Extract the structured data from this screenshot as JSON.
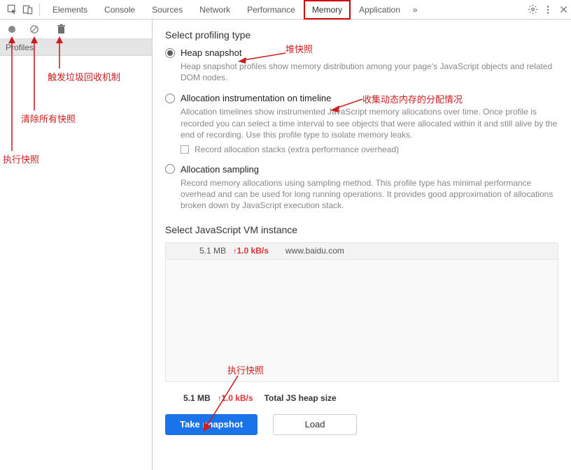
{
  "tabs": {
    "elements": "Elements",
    "console": "Console",
    "sources": "Sources",
    "network": "Network",
    "performance": "Performance",
    "memory": "Memory",
    "application": "Application",
    "more": "»"
  },
  "sidebar": {
    "profiles_label": "Profiles"
  },
  "panel": {
    "section_type": "Select profiling type",
    "heap": {
      "title": "Heap snapshot",
      "desc": "Heap snapshot profiles show memory distribution among your page's JavaScript objects and related DOM nodes."
    },
    "alloc_timeline": {
      "title": "Allocation instrumentation on timeline",
      "desc": "Allocation timelines show instrumented JavaScript memory allocations over time. Once profile is recorded you can select a time interval to see objects that were allocated within it and still alive by the end of recording. Use this profile type to isolate memory leaks.",
      "checkbox": "Record allocation stacks (extra performance overhead)"
    },
    "alloc_sampling": {
      "title": "Allocation sampling",
      "desc": "Record memory allocations using sampling method. This profile type has minimal performance overhead and can be used for long running operations. It provides good approximation of allocations broken down by JavaScript execution stack."
    },
    "section_vm": "Select JavaScript VM instance",
    "vm_row": {
      "size": "5.1 MB",
      "rate": "1.0 kB/s",
      "host": "www.baidu.com"
    },
    "footer": {
      "size": "5.1 MB",
      "rate": "1.0 kB/s",
      "label": "Total JS heap size"
    },
    "buttons": {
      "take": "Take snapshot",
      "load": "Load"
    }
  },
  "annotations": {
    "heap": "堆快照",
    "collect_dynamic": "收集动态内存的分配情况",
    "trigger_gc": "触发垃圾回收机制",
    "clear_all": "清除所有快照",
    "exec_snapshot": "执行快照",
    "exec_snapshot2": "执行快照"
  }
}
